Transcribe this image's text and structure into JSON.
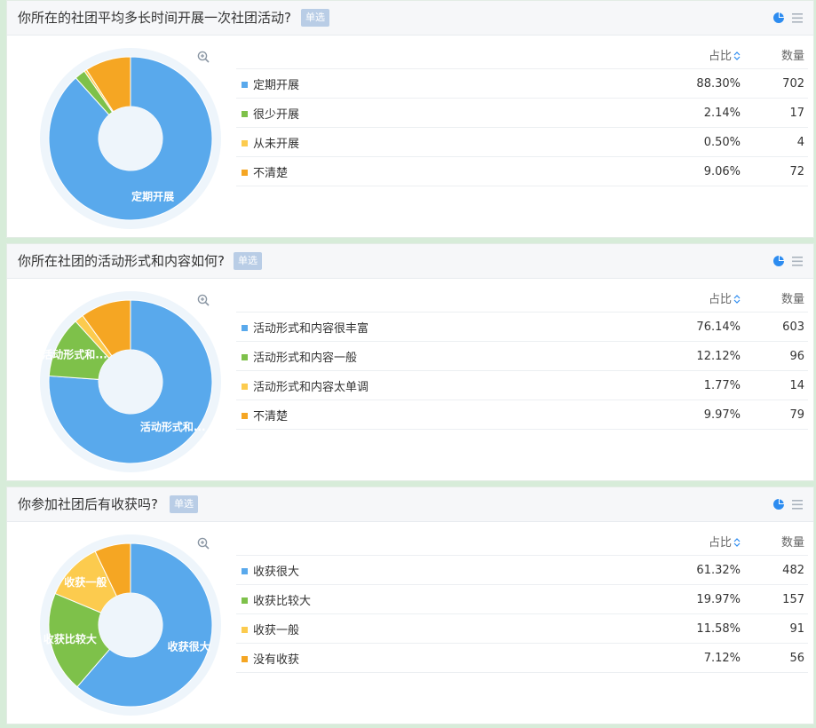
{
  "labels": {
    "tag": "单选",
    "col_pct": "占比",
    "col_count": "数量"
  },
  "colors": {
    "blue": "#59a9ec",
    "green": "#7ec14a",
    "yellow": "#fccb4e",
    "orange": "#f5a623",
    "tag_bg": "#b9cde6",
    "icon_blue": "#2d8cf0"
  },
  "icons": [
    "pie-chart-icon",
    "list-icon",
    "zoom-in-icon",
    "sort-icon"
  ],
  "questions": [
    {
      "title": "你所在的社团平均多长时间开展一次社团活动?",
      "options": [
        {
          "label": "定期开展",
          "pct": "88.30%",
          "count": "702",
          "value": 702,
          "color": "#59a9ec"
        },
        {
          "label": "很少开展",
          "pct": "2.14%",
          "count": "17",
          "value": 17,
          "color": "#7ec14a"
        },
        {
          "label": "从未开展",
          "pct": "0.50%",
          "count": "4",
          "value": 4,
          "color": "#fccb4e"
        },
        {
          "label": "不清楚",
          "pct": "9.06%",
          "count": "72",
          "value": 72,
          "color": "#f5a623"
        }
      ],
      "slice_labels": [
        "定期开展"
      ]
    },
    {
      "title": "你所在社团的活动形式和内容如何?",
      "options": [
        {
          "label": "活动形式和内容很丰富",
          "pct": "76.14%",
          "count": "603",
          "value": 603,
          "color": "#59a9ec"
        },
        {
          "label": "活动形式和内容一般",
          "pct": "12.12%",
          "count": "96",
          "value": 96,
          "color": "#7ec14a"
        },
        {
          "label": "活动形式和内容太单调",
          "pct": "1.77%",
          "count": "14",
          "value": 14,
          "color": "#fccb4e"
        },
        {
          "label": "不清楚",
          "pct": "9.97%",
          "count": "79",
          "value": 79,
          "color": "#f5a623"
        }
      ],
      "slice_labels": [
        "活动形式和...",
        "活动形式和..."
      ]
    },
    {
      "title": "你参加社团后有收获吗?",
      "options": [
        {
          "label": "收获很大",
          "pct": "61.32%",
          "count": "482",
          "value": 482,
          "color": "#59a9ec"
        },
        {
          "label": "收获比较大",
          "pct": "19.97%",
          "count": "157",
          "value": 157,
          "color": "#7ec14a"
        },
        {
          "label": "收获一般",
          "pct": "11.58%",
          "count": "91",
          "value": 91,
          "color": "#fccb4e"
        },
        {
          "label": "没有收获",
          "pct": "7.12%",
          "count": "56",
          "value": 56,
          "color": "#f5a623"
        }
      ],
      "slice_labels": [
        "收获很大",
        "收获比较大",
        "收获一般"
      ]
    }
  ],
  "chart_data": [
    {
      "type": "pie",
      "categories": [
        "定期开展",
        "很少开展",
        "从未开展",
        "不清楚"
      ],
      "values": [
        702,
        17,
        4,
        72
      ]
    },
    {
      "type": "pie",
      "categories": [
        "活动形式和内容很丰富",
        "活动形式和内容一般",
        "活动形式和内容太单调",
        "不清楚"
      ],
      "values": [
        603,
        96,
        14,
        79
      ]
    },
    {
      "type": "pie",
      "categories": [
        "收获很大",
        "收获比较大",
        "收获一般",
        "没有收获"
      ],
      "values": [
        482,
        157,
        91,
        56
      ]
    }
  ]
}
